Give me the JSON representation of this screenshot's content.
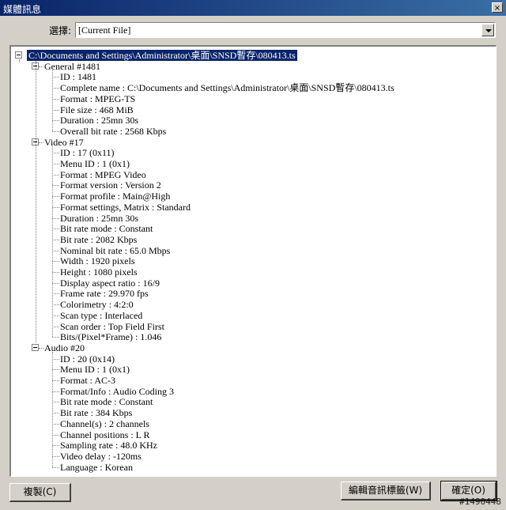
{
  "window": {
    "title": "媒體訊息",
    "close_glyph": "×"
  },
  "selector": {
    "label": "選擇:",
    "value": "[Current File]"
  },
  "tree": {
    "root": "C:\\Documents and Settings\\Administrator\\桌面\\SNSD暫存\\080413.ts",
    "sections": [
      {
        "title": "General #1481",
        "items": [
          "ID : 1481",
          "Complete name : C:\\Documents and Settings\\Administrator\\桌面\\SNSD暫存\\080413.ts",
          "Format : MPEG-TS",
          "File size : 468 MiB",
          "Duration : 25mn 30s",
          "Overall bit rate : 2568 Kbps"
        ]
      },
      {
        "title": "Video #17",
        "items": [
          "ID : 17 (0x11)",
          "Menu ID : 1 (0x1)",
          "Format : MPEG Video",
          "Format version : Version 2",
          "Format profile : Main@High",
          "Format settings, Matrix : Standard",
          "Duration : 25mn 30s",
          "Bit rate mode : Constant",
          "Bit rate : 2082 Kbps",
          "Nominal bit rate : 65.0 Mbps",
          "Width : 1920 pixels",
          "Height : 1080 pixels",
          "Display aspect ratio : 16/9",
          "Frame rate : 29.970 fps",
          "Colorimetry : 4:2:0",
          "Scan type : Interlaced",
          "Scan order : Top Field First",
          "Bits/(Pixel*Frame) : 1.046"
        ]
      },
      {
        "title": "Audio #20",
        "items": [
          "ID : 20 (0x14)",
          "Menu ID : 1 (0x1)",
          "Format : AC-3",
          "Format/Info : Audio Coding 3",
          "Bit rate mode : Constant",
          "Bit rate : 384 Kbps",
          "Channel(s) : 2 channels",
          "Channel positions : L R",
          "Sampling rate : 48.0 KHz",
          "Video delay : -120ms",
          "Language : Korean"
        ]
      }
    ]
  },
  "buttons": {
    "copy": "複製(C)",
    "edit_tags": "編輯音訊標籤(W)",
    "ok": "確定(O)"
  },
  "watermark": "#1490448",
  "colors": {
    "selection": "#0a246a",
    "face": "#d4d0c8",
    "title_gradient_start": "#0a246a",
    "title_gradient_end": "#3a6ea5"
  }
}
